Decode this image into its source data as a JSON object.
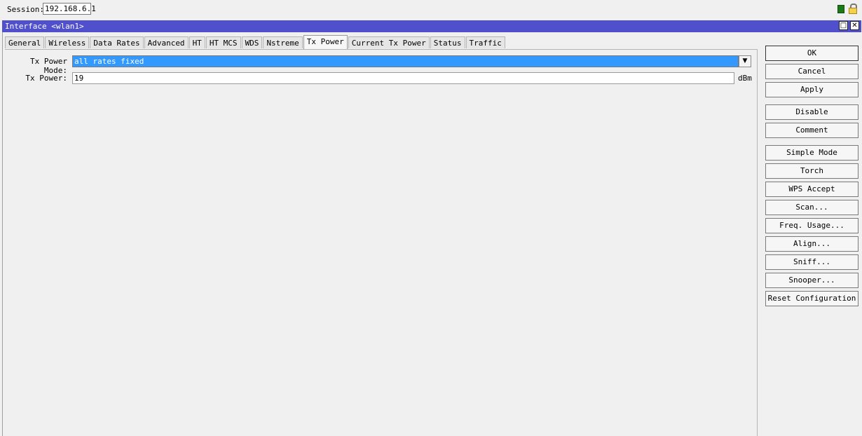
{
  "session": {
    "label": "Session:",
    "value": "192.168.6.1"
  },
  "window": {
    "title": "Interface <wlan1>",
    "restore_glyph": "□",
    "close_glyph": "✕"
  },
  "tabs": [
    {
      "label": "General"
    },
    {
      "label": "Wireless"
    },
    {
      "label": "Data Rates"
    },
    {
      "label": "Advanced"
    },
    {
      "label": "HT"
    },
    {
      "label": "HT MCS"
    },
    {
      "label": "WDS"
    },
    {
      "label": "Nstreme"
    },
    {
      "label": "Tx Power",
      "active": true
    },
    {
      "label": "Current Tx Power"
    },
    {
      "label": "Status"
    },
    {
      "label": "Traffic"
    }
  ],
  "form": {
    "tx_power_mode": {
      "label": "Tx Power Mode:",
      "value": "all rates fixed",
      "dropdown_glyph": "▼"
    },
    "tx_power": {
      "label": "Tx Power:",
      "value": "19",
      "unit": "dBm"
    }
  },
  "buttons": {
    "ok": "OK",
    "cancel": "Cancel",
    "apply": "Apply",
    "disable": "Disable",
    "comment": "Comment",
    "simple_mode": "Simple Mode",
    "torch": "Torch",
    "wps_accept": "WPS Accept",
    "scan": "Scan...",
    "freq_usage": "Freq. Usage...",
    "align": "Align...",
    "sniff": "Sniff...",
    "snooper": "Snooper...",
    "reset_configuration": "Reset Configuration"
  },
  "icons": {
    "status": "status-square-icon",
    "lock": "lock-icon"
  },
  "colors": {
    "titlebar": "#5050cc",
    "selection": "#3399ff",
    "status_green": "#1a7a1a",
    "lock_gold": "#f3d24a"
  }
}
